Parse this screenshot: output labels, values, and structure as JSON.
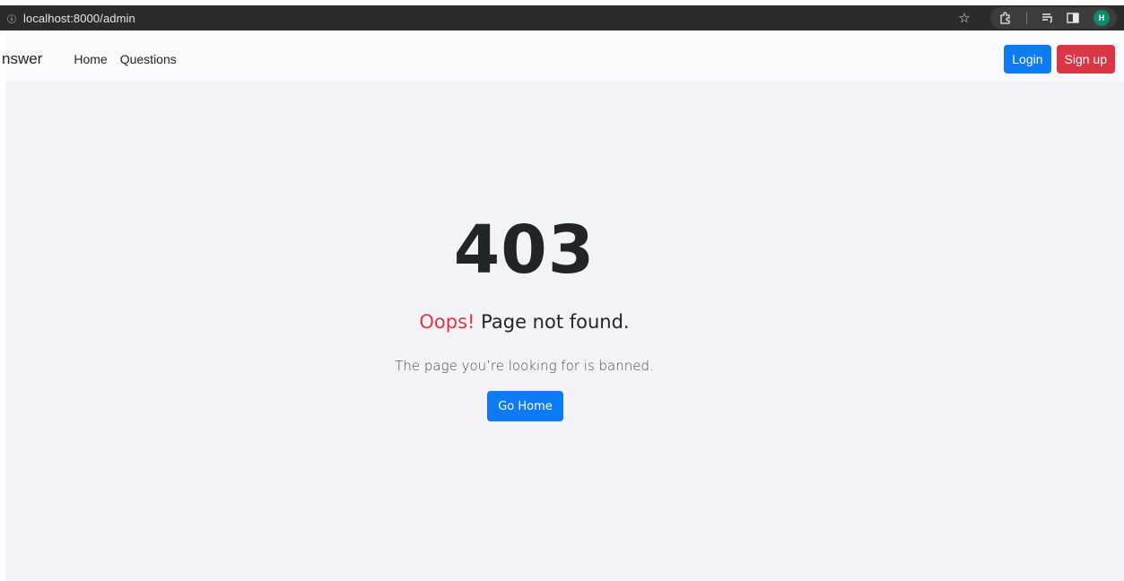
{
  "browser": {
    "url": "localhost:8000/admin",
    "profile_initial": "H"
  },
  "navbar": {
    "brand": "nswer",
    "links": [
      "Home",
      "Questions"
    ],
    "login_label": "Login",
    "signup_label": "Sign up"
  },
  "error": {
    "code": "403",
    "oops": "Oops!",
    "title": "Page not found.",
    "message": "The page you’re looking for is banned.",
    "button_label": "Go Home"
  },
  "colors": {
    "primary": "#0d7bf5",
    "danger": "#dc3545",
    "background": "#f3f3f7",
    "navbar": "#f8f9fa"
  }
}
